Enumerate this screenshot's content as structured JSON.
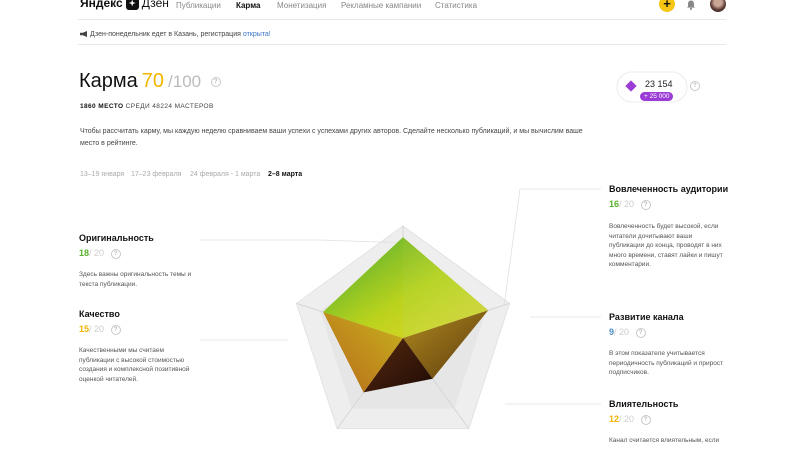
{
  "header": {
    "logo_text_bold": "Яндекс",
    "logo_text": "Дзен",
    "nav": [
      {
        "label": "Публикации",
        "active": false
      },
      {
        "label": "Карма",
        "active": true
      },
      {
        "label": "Монетизация",
        "active": false
      },
      {
        "label": "Рекламные кампании",
        "active": false
      },
      {
        "label": "Статистика",
        "active": false
      }
    ],
    "add_label": "+"
  },
  "announcement": {
    "text": "Дзен-понедельник едет в Казань, регистрация ",
    "link": "открыта!"
  },
  "karma": {
    "title": "Карма",
    "score": "70",
    "max": "/100",
    "help": "?",
    "place_number": "1860 МЕСТО",
    "place_rest": "СРЕДИ 48224 МАСТЕРОВ",
    "description": "Чтобы рассчитать карму, мы каждую неделю сравниваем ваши успехи с успехами других авторов. Сделайте несколько публикаций, и мы вычислим ваше место в рейтинге."
  },
  "weeks": [
    {
      "label": "13–19 января",
      "selected": false
    },
    {
      "label": "17–23 февраля",
      "selected": false
    },
    {
      "label": "24 февраля - 1 марта",
      "selected": false
    },
    {
      "label": "2–8 марта",
      "selected": true
    }
  ],
  "badge": {
    "value": "23 154",
    "delta": "+ 25 000",
    "help": "?",
    "color": "#9b3cd6"
  },
  "criteria": {
    "originality": {
      "title": "Оригинальность",
      "score": "18",
      "max": "/ 20",
      "score_color": "#5ab22e",
      "description": "Здесь важны оригинальность темы и текста публикации."
    },
    "quality": {
      "title": "Качество",
      "score": "15",
      "max": "/ 20",
      "score_color": "#f4b400",
      "description": "Качественными мы считаем публикации с высокой стоимостью создания и комплексной позитивной оценкой читателей."
    },
    "engagement": {
      "title": "Вовлеченность аудитории",
      "score": "16",
      "max": "/ 20",
      "score_color": "#5ab22e",
      "description": "Вовлеченность будет высокой, если читатели дочитывают ваши публикации до конца, проводят в них много времени, ставят лайки и пишут комментарии."
    },
    "growth": {
      "title": "Развитие канала",
      "score": "9",
      "max": "/ 20",
      "score_color": "#4a90c8",
      "description": "В этом показателе учитывается периодичность публикаций и прирост подписчиков."
    },
    "influence": {
      "title": "Влиятельность",
      "score": "12",
      "max": "/ 20",
      "score_color": "#f4b400",
      "description": "Канал считается влиятельным, если"
    }
  },
  "radar": {
    "values": {
      "originality": 18,
      "engagement": 16,
      "growth": 9,
      "influence": 12,
      "quality": 15
    },
    "max": 20
  }
}
